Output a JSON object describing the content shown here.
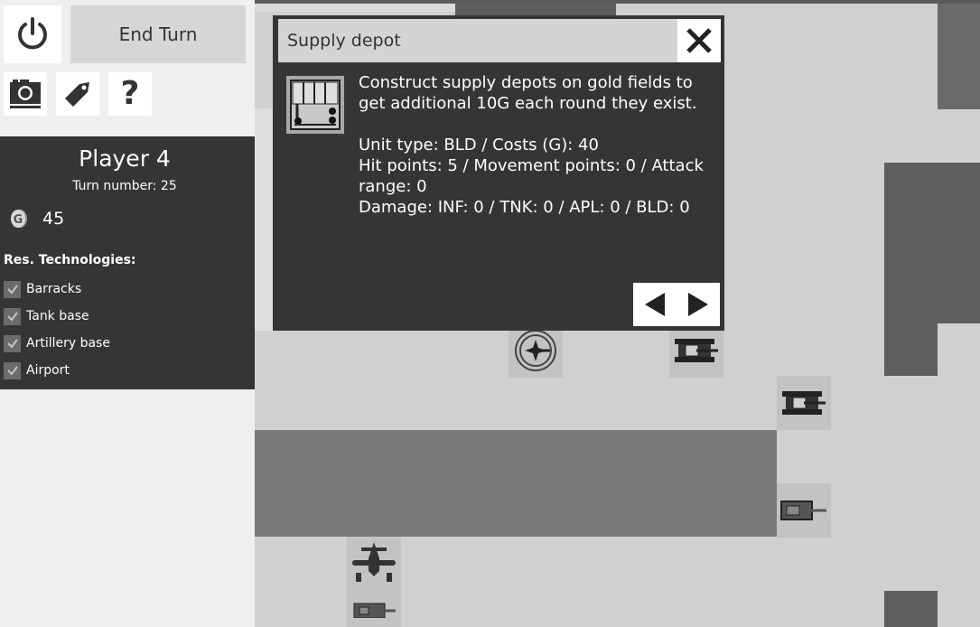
{
  "toolbar": {
    "power_icon": "power-icon",
    "end_turn_label": "End Turn",
    "camera_icon": "camera-icon",
    "tag_icon": "tag-icon",
    "help_label": "?"
  },
  "player": {
    "name": "Player 4",
    "turn_text": "Turn number: 25",
    "gold_icon": "gold-coin-icon",
    "gold": "45"
  },
  "technologies": {
    "title": "Res. Technologies:",
    "items": [
      {
        "label": "Barracks",
        "checked": true
      },
      {
        "label": "Tank base",
        "checked": true
      },
      {
        "label": "Artillery base",
        "checked": true
      },
      {
        "label": "Airport",
        "checked": true
      }
    ]
  },
  "dialog": {
    "title": "Supply depot",
    "image_icon": "supply-depot-icon",
    "description": "Construct supply depots on gold fields to get additional 10G each round they exist.",
    "unit_type": "Unit type: BLD / Costs (G): 40",
    "stats": "Hit points: 5 / Movement points: 0 / Attack range: 0",
    "damage": "Damage: INF: 0 / TNK: 0 / APL: 0 / BLD: 0"
  },
  "map": {
    "units": [
      "compass-target-icon",
      "tank-icon",
      "tank-icon",
      "tank-icon",
      "airplane-icon",
      "tank-icon"
    ]
  },
  "colors": {
    "sidebar_bg": "#efefef",
    "panel_bg": "#353535",
    "map_light": "#d0d0d0",
    "map_dark": "#5e5e5e",
    "map_mid": "#7a7a7a"
  }
}
